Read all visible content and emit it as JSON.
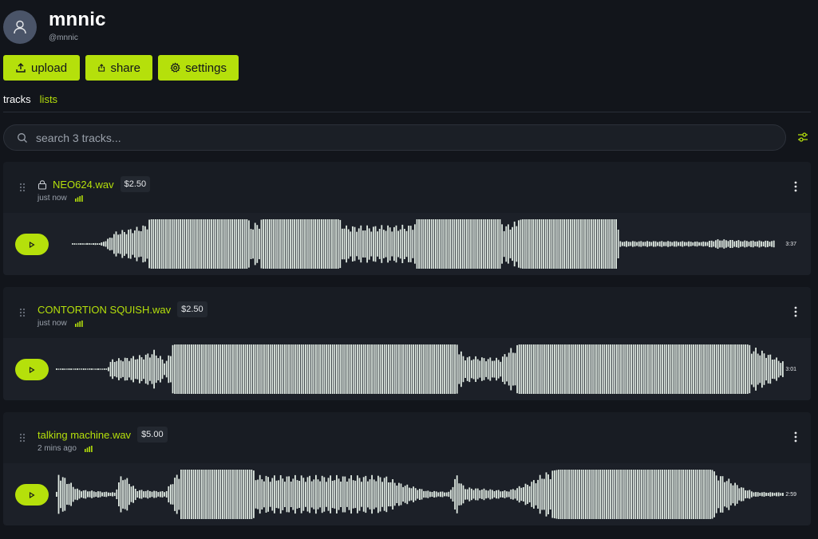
{
  "profile": {
    "display_name": "mnnic",
    "handle": "@mnnic",
    "avatar_icon": "user-icon"
  },
  "actions": {
    "upload": "upload",
    "share": "share",
    "settings": "settings"
  },
  "tabs": [
    {
      "label": "tracks",
      "active": true
    },
    {
      "label": "lists",
      "active": false
    }
  ],
  "search": {
    "placeholder": "search 3 tracks..."
  },
  "colors": {
    "accent": "#b5e00b",
    "background": "#12151b",
    "waveform": "#dfe9e2"
  },
  "tracks": [
    {
      "title": "NEO624.wav",
      "price": "$2.50",
      "time": "just now",
      "duration": "3:37",
      "locked": true
    },
    {
      "title": "CONTORTION SQUISH.wav",
      "price": "$2.50",
      "time": "just now",
      "duration": "3:01",
      "locked": false
    },
    {
      "title": "talking machine.wav",
      "price": "$5.00",
      "time": "2 mins ago",
      "duration": "2:59",
      "locked": false
    }
  ]
}
